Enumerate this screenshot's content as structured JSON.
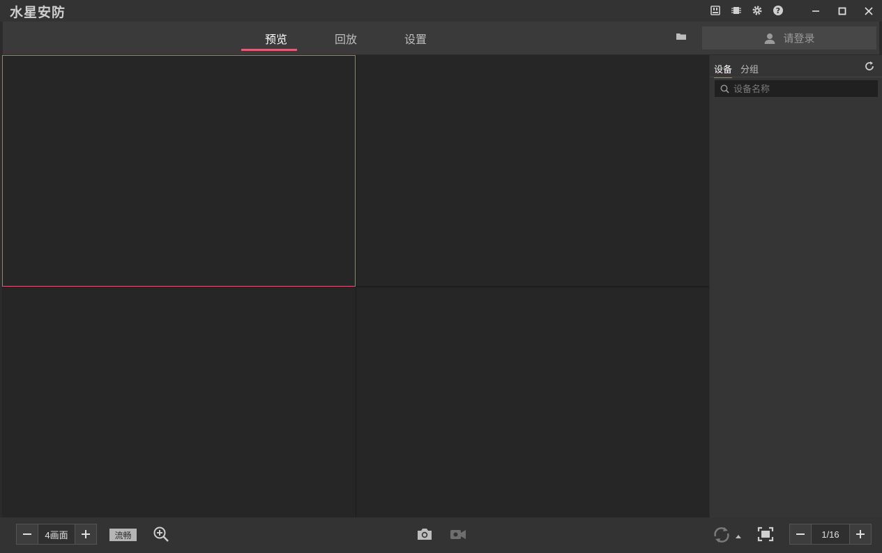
{
  "app": {
    "title": "水星安防"
  },
  "nav": {
    "tabs": [
      {
        "label": "预览",
        "active": true
      },
      {
        "label": "回放",
        "active": false
      },
      {
        "label": "设置",
        "active": false
      }
    ],
    "login_label": "请登录"
  },
  "side": {
    "tabs": [
      {
        "label": "设备",
        "active": true
      },
      {
        "label": "分组",
        "active": false
      }
    ],
    "search_placeholder": "设备名称"
  },
  "bottom": {
    "layout_label": "4画面",
    "stream_label": "流畅",
    "page_label": "1/16"
  },
  "colors": {
    "accent": "#e06072",
    "background": "#2b2b2b",
    "cell": "#262626"
  },
  "icons": [
    "memory-card-icon",
    "chip-icon",
    "gear-icon",
    "help-icon",
    "minimize-icon",
    "maximize-icon",
    "close-icon",
    "folder-icon",
    "user-icon",
    "refresh-icon",
    "search-icon",
    "minus-icon",
    "plus-icon",
    "zoom-in-icon",
    "camera-icon",
    "record-icon",
    "rotate-icon",
    "caret-up-icon",
    "fit-screen-icon"
  ]
}
